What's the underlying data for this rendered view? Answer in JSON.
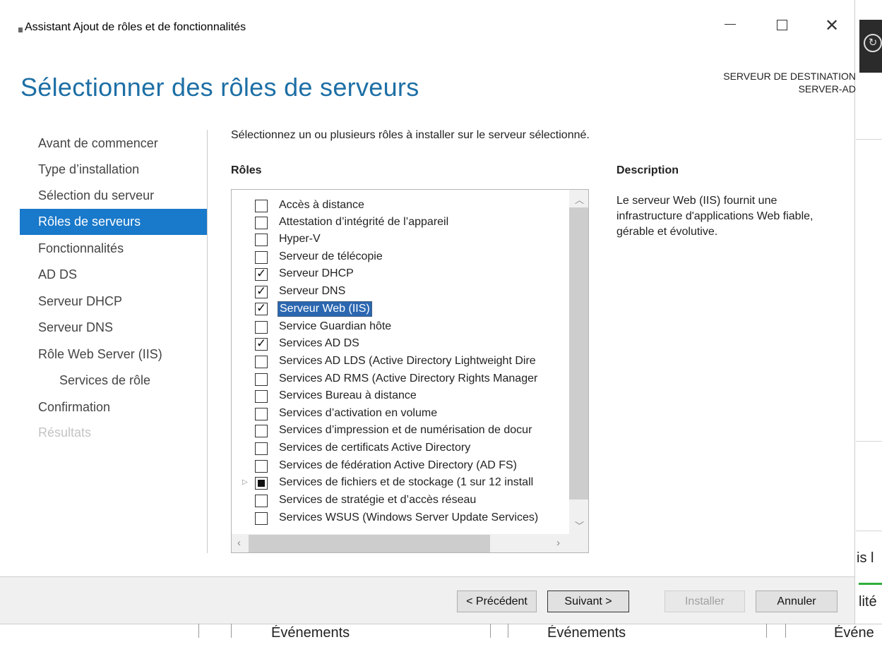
{
  "window": {
    "title": "Assistant Ajout de rôles et de fonctionnalités",
    "minimize_glyph": "",
    "close_glyph": "✕"
  },
  "page": {
    "heading": "Sélectionner des rôles de serveurs",
    "destination_label": "SERVEUR DE DESTINATION",
    "destination_server": "SERVER-AD",
    "instruction": "Sélectionnez un ou plusieurs rôles à installer sur le serveur sélectionné.",
    "roles_header": "Rôles",
    "description_header": "Description",
    "description_text": "Le serveur Web (IIS) fournit une infrastructure d'applications Web fiable, gérable et évolutive."
  },
  "nav": [
    {
      "label": "Avant de commencer",
      "state": "normal"
    },
    {
      "label": "Type d’installation",
      "state": "normal"
    },
    {
      "label": "Sélection du serveur",
      "state": "normal"
    },
    {
      "label": "Rôles de serveurs",
      "state": "active"
    },
    {
      "label": "Fonctionnalités",
      "state": "normal"
    },
    {
      "label": "AD DS",
      "state": "normal"
    },
    {
      "label": "Serveur DHCP",
      "state": "normal"
    },
    {
      "label": "Serveur DNS",
      "state": "normal"
    },
    {
      "label": "Rôle Web Server (IIS)",
      "state": "normal"
    },
    {
      "label": "Services de rôle",
      "state": "sub"
    },
    {
      "label": "Confirmation",
      "state": "normal"
    },
    {
      "label": "Résultats",
      "state": "disabled"
    }
  ],
  "roles": [
    {
      "label": "Accès à distance",
      "checked": false
    },
    {
      "label": "Attestation d’intégrité de l’appareil",
      "checked": false
    },
    {
      "label": "Hyper-V",
      "checked": false
    },
    {
      "label": "Serveur de télécopie",
      "checked": false
    },
    {
      "label": "Serveur DHCP",
      "checked": true
    },
    {
      "label": "Serveur DNS",
      "checked": true
    },
    {
      "label": "Serveur Web (IIS)",
      "checked": true,
      "selected": true
    },
    {
      "label": "Service Guardian hôte",
      "checked": false
    },
    {
      "label": "Services AD DS",
      "checked": true
    },
    {
      "label": "Services AD LDS (Active Directory Lightweight Dire",
      "checked": false
    },
    {
      "label": "Services AD RMS (Active Directory Rights Manager",
      "checked": false
    },
    {
      "label": "Services Bureau à distance",
      "checked": false
    },
    {
      "label": "Services d’activation en volume",
      "checked": false
    },
    {
      "label": "Services d’impression et de numérisation de docur",
      "checked": false
    },
    {
      "label": "Services de certificats Active Directory",
      "checked": false
    },
    {
      "label": "Services de fédération Active Directory (AD FS)",
      "checked": false
    },
    {
      "label": "Services de fichiers et de stockage (1 sur 12 install",
      "checked": "partial",
      "expandable": true
    },
    {
      "label": "Services de stratégie et d’accès réseau",
      "checked": false
    },
    {
      "label": "Services WSUS (Windows Server Update Services)",
      "checked": false
    }
  ],
  "buttons": {
    "previous": "< Précédent",
    "next": "Suivant >",
    "install": "Installer",
    "cancel": "Annuler"
  },
  "background": {
    "right_text_1": "is l",
    "right_text_2": "lité",
    "events": [
      "Événements",
      "Événements",
      "Événe"
    ]
  },
  "icons": {
    "sync": "sync-icon",
    "expander": "triangle-right-icon",
    "scroll_up": "chevron-up-icon",
    "scroll_down": "chevron-down-icon",
    "scroll_left": "chevron-left-icon",
    "scroll_right": "chevron-right-icon"
  },
  "colors": {
    "heading": "#1d6fa5",
    "nav_active": "#1979ca",
    "selection": "#2b67b1",
    "green_accent": "#2fae3b"
  }
}
